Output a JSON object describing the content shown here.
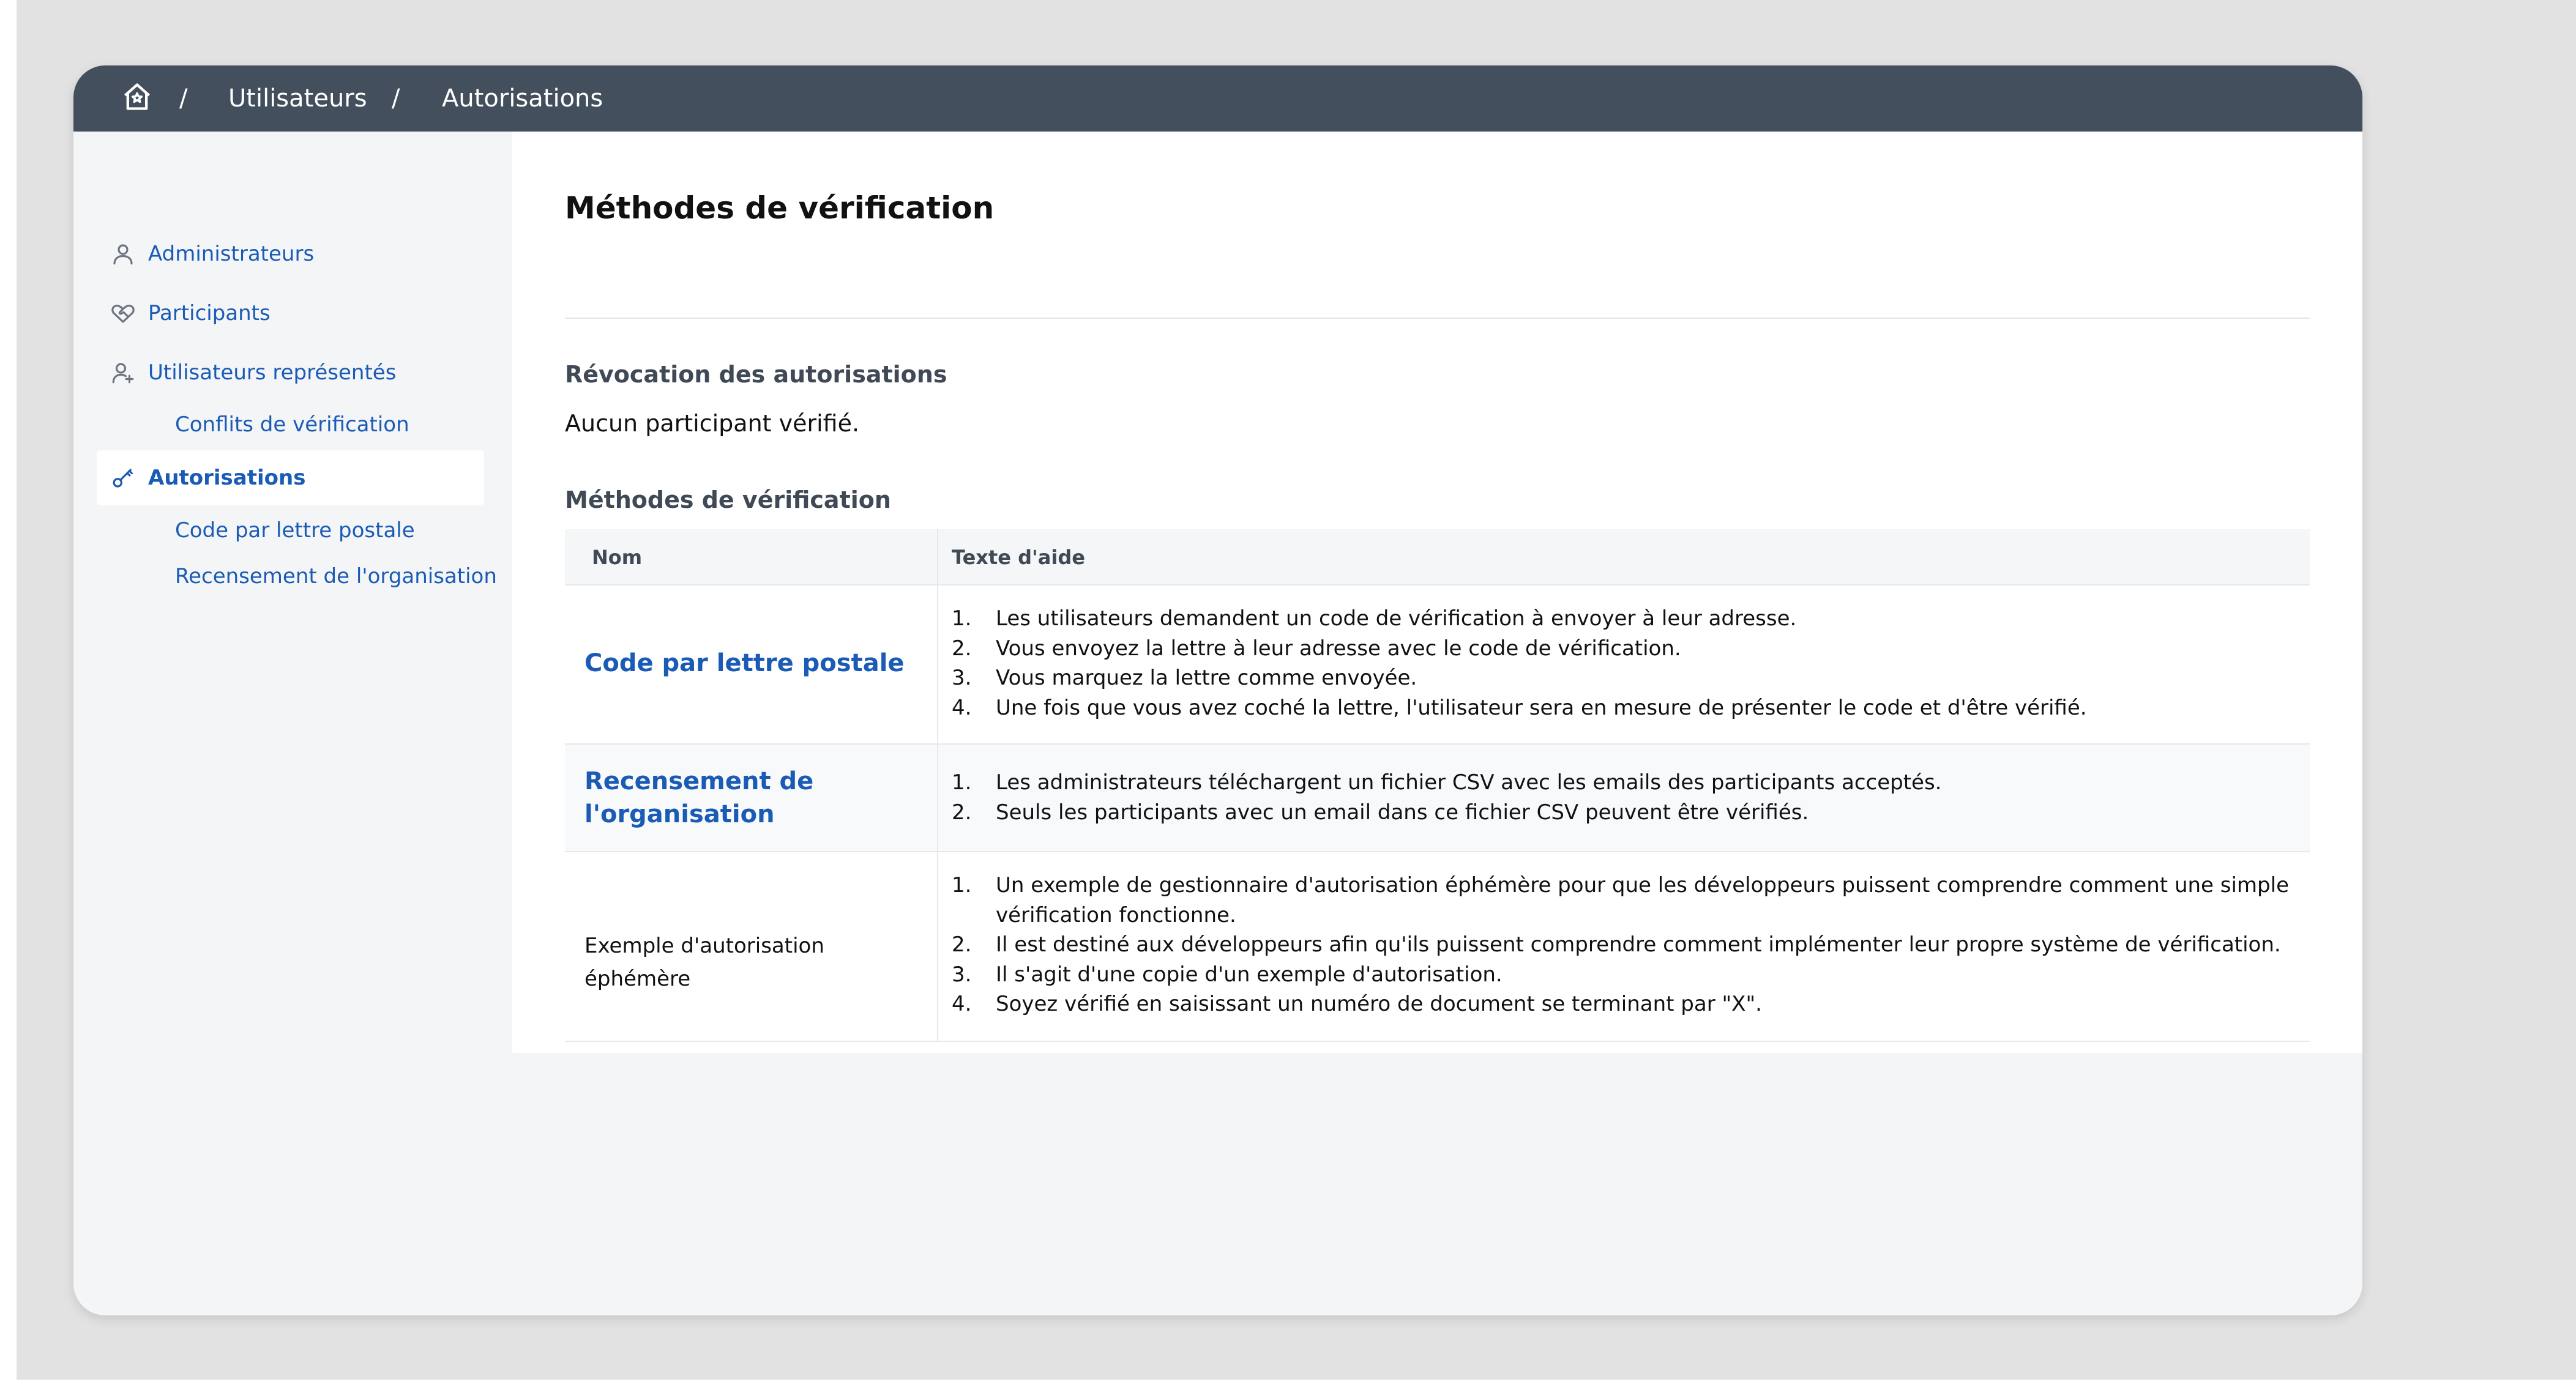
{
  "breadcrumb": {
    "home_icon": "home-icon",
    "separator": "/",
    "items": [
      "Utilisateurs",
      "Autorisations"
    ]
  },
  "sidebar": {
    "items": [
      {
        "label": "Administrateurs",
        "icon": "user-icon"
      },
      {
        "label": "Participants",
        "icon": "heart-handshake-icon"
      },
      {
        "label": "Utilisateurs représentés",
        "icon": "user-plus-icon"
      },
      {
        "label": "Autorisations",
        "icon": "key-icon",
        "active": true
      }
    ],
    "subitems": {
      "represented": [
        "Conflits de vérification"
      ],
      "authorizations": [
        "Code par lettre postale",
        "Recensement de l'organisation"
      ]
    }
  },
  "main": {
    "title": "Méthodes de vérification",
    "revocation": {
      "heading": "Révocation des autorisations",
      "text": "Aucun participant vérifié."
    },
    "methods_heading": "Méthodes de vérification",
    "table": {
      "headers": {
        "name": "Nom",
        "help": "Texte d'aide"
      },
      "rows": [
        {
          "name": "Code par lettre postale",
          "help": [
            "Les utilisateurs demandent un code de vérification à envoyer à leur adresse.",
            "Vous envoyez la lettre à leur adresse avec le code de vérification.",
            "Vous marquez la lettre comme envoyée.",
            "Une fois que vous avez coché la lettre, l'utilisateur sera en mesure de présenter le code et d'être vérifié."
          ]
        },
        {
          "name": "Recensement de l'organisation",
          "help": [
            "Les administrateurs téléchargent un fichier CSV avec les emails des participants acceptés.",
            "Seuls les participants avec un email dans ce fichier CSV peuvent être vérifiés."
          ]
        },
        {
          "name": "Exemple d'autorisation éphémère",
          "help": [
            "Un exemple de gestionnaire d'autorisation éphémère pour que les développeurs puissent comprendre comment une simple vérification fonctionne.",
            "Il est destiné aux développeurs afin qu'ils puissent comprendre comment implémenter leur propre système de vérification.",
            "Il s'agit d'une copie d'un exemple d'autorisation.",
            "Soyez vérifié en saisissant un numéro de document se terminant par \"X\"."
          ]
        }
      ]
    }
  },
  "colors": {
    "topbar": "#434f5c",
    "link": "#1a5bb5",
    "page_bg": "#f4f5f7"
  }
}
